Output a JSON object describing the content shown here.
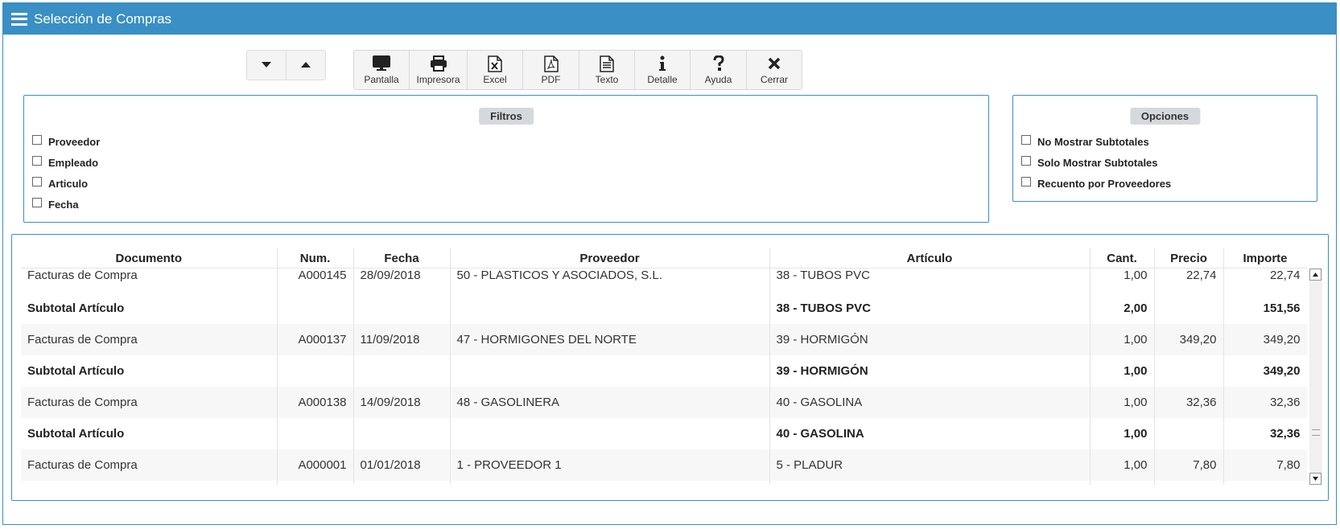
{
  "window": {
    "title": "Selección de Compras"
  },
  "toolbar": {
    "buttons": [
      {
        "label": "Pantalla",
        "icon": "monitor-icon"
      },
      {
        "label": "Impresora",
        "icon": "printer-icon"
      },
      {
        "label": "Excel",
        "icon": "excel-icon"
      },
      {
        "label": "PDF",
        "icon": "pdf-icon"
      },
      {
        "label": "Texto",
        "icon": "text-file-icon"
      },
      {
        "label": "Detalle",
        "icon": "info-icon"
      },
      {
        "label": "Ayuda",
        "icon": "question-icon"
      },
      {
        "label": "Cerrar",
        "icon": "close-icon"
      }
    ]
  },
  "filters": {
    "title": "Filtros",
    "items": [
      "Proveedor",
      "Empleado",
      "Articulo",
      "Fecha"
    ]
  },
  "options": {
    "title": "Opciones",
    "items": [
      "No Mostrar Subtotales",
      "Solo Mostrar Subtotales",
      "Recuento por Proveedores"
    ]
  },
  "table": {
    "headers": [
      "Documento",
      "Num.",
      "Fecha",
      "Proveedor",
      "Artículo",
      "Cant.",
      "Precio",
      "Importe"
    ],
    "rows": [
      [
        "Facturas de Compra",
        "A000145",
        "28/09/2018",
        "50 - PLASTICOS Y ASOCIADOS, S.L.",
        "38 - TUBOS PVC",
        "1,00",
        "22,74",
        "22,74"
      ],
      [
        "Subtotal Artículo",
        "",
        "",
        "",
        "38 - TUBOS PVC",
        "2,00",
        "",
        "151,56"
      ],
      [
        "Facturas de Compra",
        "A000137",
        "11/09/2018",
        "47 - HORMIGONES DEL NORTE",
        "39 - HORMIGÓN",
        "1,00",
        "349,20",
        "349,20"
      ],
      [
        "Subtotal Artículo",
        "",
        "",
        "",
        "39 - HORMIGÓN",
        "1,00",
        "",
        "349,20"
      ],
      [
        "Facturas de Compra",
        "A000138",
        "14/09/2018",
        "48 - GASOLINERA",
        "40 - GASOLINA",
        "1,00",
        "32,36",
        "32,36"
      ],
      [
        "Subtotal Artículo",
        "",
        "",
        "",
        "40 - GASOLINA",
        "1,00",
        "",
        "32,36"
      ],
      [
        "Facturas de Compra",
        "A000001",
        "01/01/2018",
        "1 - PROVEEDOR 1",
        "5 - PLADUR",
        "1,00",
        "7,80",
        "7,80"
      ],
      [
        "",
        "",
        "",
        "",
        "",
        "",
        "",
        ""
      ]
    ]
  }
}
